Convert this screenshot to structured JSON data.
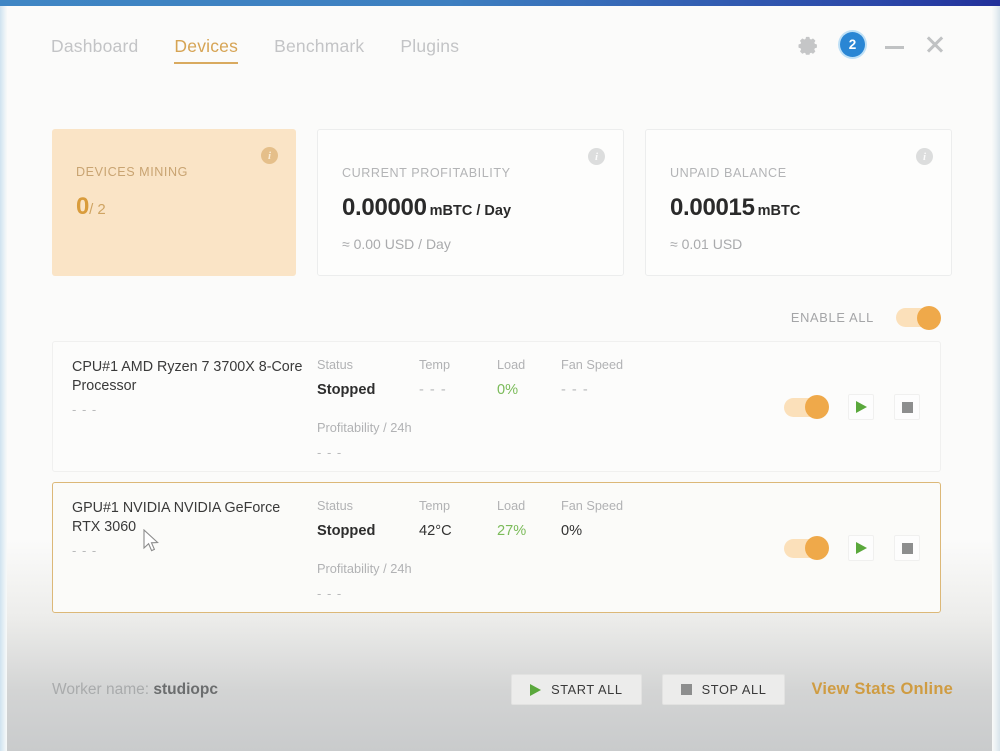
{
  "header": {
    "tabs": [
      {
        "label": "Dashboard",
        "active": false
      },
      {
        "label": "Devices",
        "active": true
      },
      {
        "label": "Benchmark",
        "active": false
      },
      {
        "label": "Plugins",
        "active": false
      }
    ],
    "gear_icon": "gear-icon",
    "notification_count": "2",
    "minimize_icon": "minimize-icon",
    "close_icon": "close-icon"
  },
  "colors": {
    "accent_orange": "#d99c3c",
    "toggle_on": "#efa94a",
    "badge_blue": "#2a86d4",
    "green": "#7bbb5a",
    "titlebar_blue": "#3f86c4",
    "card_highlight_bg": "#fae4c6"
  },
  "stat_cards": [
    {
      "name": "devices-mining",
      "label": "DEVICES MINING",
      "value": "0",
      "unit": "/ 2",
      "sub": "",
      "info_icon": "info-icon"
    },
    {
      "name": "current-profitability",
      "label": "CURRENT PROFITABILITY",
      "value": "0.00000",
      "unit": "mBTC / Day",
      "sub": "≈ 0.00 USD / Day",
      "info_icon": "info-icon"
    },
    {
      "name": "unpaid-balance",
      "label": "UNPAID BALANCE",
      "value": "0.00015",
      "unit": "mBTC",
      "sub": "≈ 0.01 USD",
      "info_icon": "info-icon"
    }
  ],
  "enable_all": {
    "label": "ENABLE ALL",
    "toggle_state": "on"
  },
  "device_columns": {
    "status": "Status",
    "temp": "Temp",
    "load": "Load",
    "fan_speed": "Fan Speed",
    "profitability": "Profitability / 24h"
  },
  "devices": [
    {
      "name": "CPU#1 AMD Ryzen 7 3700X 8-Core Processor",
      "subtitle": "- - -",
      "status": "Stopped",
      "temp": "- - -",
      "load": "0%",
      "fan_speed": "- - -",
      "profitability": "- - -",
      "toggle_state": "on",
      "selected": false,
      "start_icon": "play-icon",
      "stop_icon": "stop-icon"
    },
    {
      "name": "GPU#1 NVIDIA NVIDIA GeForce RTX 3060",
      "subtitle": "- - -",
      "status": "Stopped",
      "temp": "42°C",
      "load": "27%",
      "fan_speed": "0%",
      "profitability": "- - -",
      "toggle_state": "on",
      "selected": true,
      "start_icon": "play-icon",
      "stop_icon": "stop-icon"
    }
  ],
  "footer": {
    "worker_label": "Worker name:",
    "worker_value": "studiopc",
    "start_all": "START ALL",
    "stop_all": "STOP ALL",
    "view_stats": "View Stats Online"
  }
}
